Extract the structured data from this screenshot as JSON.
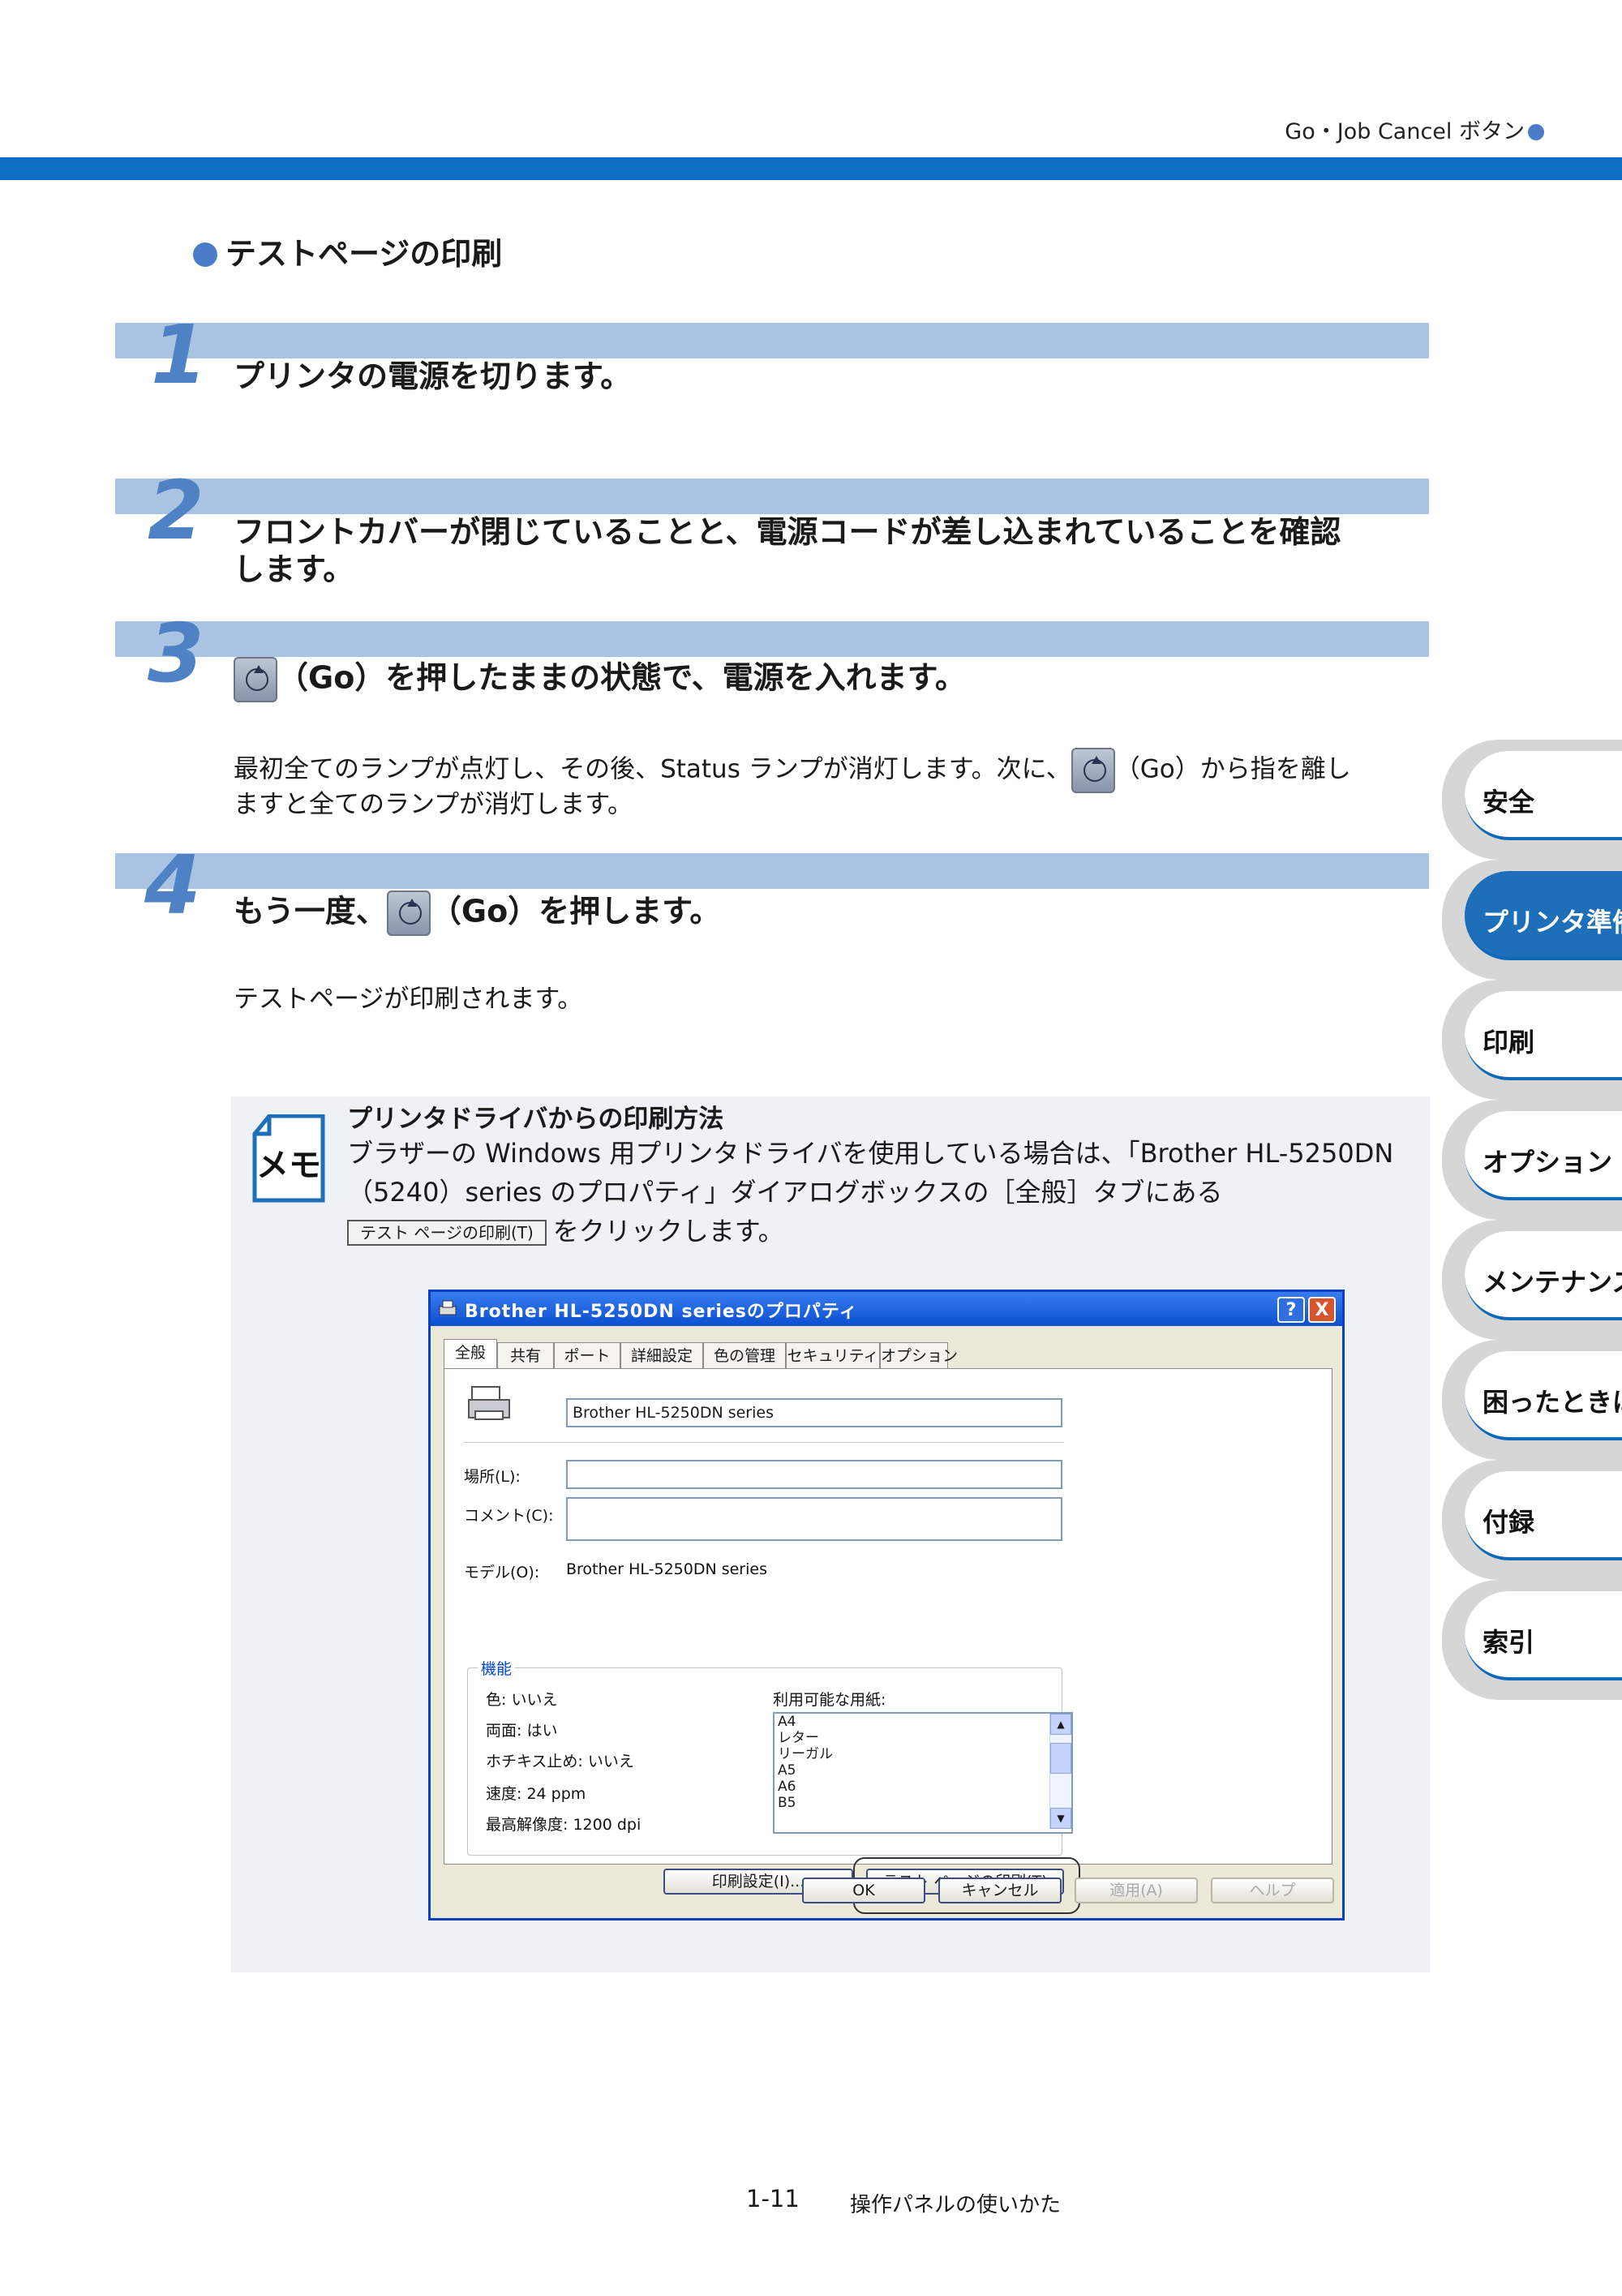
{
  "header": {
    "text": "Go・Job Cancel ボタン"
  },
  "section_title": "テストページの印刷",
  "steps": [
    {
      "num": "1",
      "text": "プリンタの電源を切ります。"
    },
    {
      "num": "2",
      "text_line1": "フロントカバーが閉じていることと、電源コードが差し込まれていることを確認",
      "text_line2": "します。"
    },
    {
      "num": "3",
      "text": "（Go）を押したままの状態で、電源を入れます。"
    },
    {
      "num": "4",
      "text_before": "もう一度、",
      "text_after": "（Go）を押します。"
    }
  ],
  "step3_body": {
    "line1_a": "最初全てのランプが点灯し、その後、Status ランプが消灯します。次に、",
    "line1_b": "（Go）から指を離し",
    "line2": "ますと全てのランプが消灯します。"
  },
  "step4_body": "テストページが印刷されます。",
  "memo": {
    "icon_text": "メモ",
    "title": "プリンタドライバからの印刷方法",
    "line1": "ブラザーの Windows 用プリンタドライバを使用している場合は、「Brother  HL-5250DN",
    "line2": "（5240）series のプロパティ」ダイアログボックスの［全般］タブにある",
    "button_label": "テスト ページの印刷(T)",
    "line3_after": "をクリックします。"
  },
  "dialog": {
    "title": "Brother HL-5250DN seriesのプロパティ",
    "help_btn": "?",
    "close_btn": "X",
    "tabs": [
      "全般",
      "共有",
      "ポート",
      "詳細設定",
      "色の管理",
      "セキュリティ",
      "オプション"
    ],
    "printer_name": "Brother HL-5250DN series",
    "location_label": "場所(L):",
    "location_value": "",
    "comment_label": "コメント(C):",
    "comment_value": "",
    "model_label": "モデル(O):",
    "model_value": "Brother HL-5250DN series",
    "features_label": "機能",
    "features": [
      "色: いいえ",
      "両面: はい",
      "ホチキス止め: いいえ",
      "速度: 24 ppm",
      "最高解像度: 1200 dpi"
    ],
    "paper_label": "利用可能な用紙:",
    "papers": [
      "A4",
      "レター",
      "リーガル",
      "A5",
      "A6",
      "B5"
    ],
    "print_settings_btn": "印刷設定(I)...",
    "test_page_btn": "テスト ページの印刷(T)",
    "ok_btn": "OK",
    "cancel_btn": "キャンセル",
    "apply_btn": "適用(A)",
    "help_btn2": "ヘルプ"
  },
  "sidebar": [
    "安全",
    "プリンタ準備",
    "印刷",
    "オプション",
    "メンテナンス",
    "困ったときは",
    "付録",
    "索引"
  ],
  "sidebar_active_index": 1,
  "footer": {
    "page": "1-11",
    "chapter": "操作パネルの使いかた"
  },
  "colors": {
    "accent_blue": "#0a6fc2",
    "step_band": "#a9c4e2",
    "step_number": "#4f82c4",
    "memo_bg": "#eef2f7"
  }
}
